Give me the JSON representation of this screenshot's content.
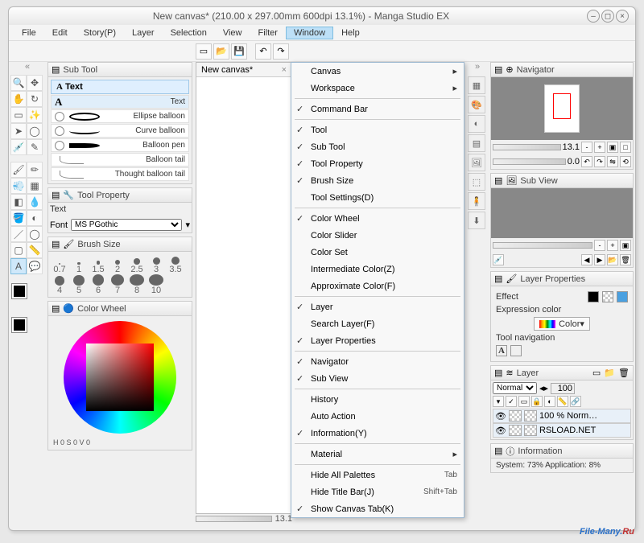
{
  "title": "New canvas* (210.00 x 297.00mm 600dpi 13.1%)  - Manga Studio EX",
  "menubar": [
    "File",
    "Edit",
    "Story(P)",
    "Layer",
    "Selection",
    "View",
    "Filter",
    "Window",
    "Help"
  ],
  "menubar_active": "Window",
  "canvas_tab": "New canvas*",
  "subtool": {
    "title": "Sub Tool",
    "tab": "Text",
    "items": [
      {
        "label": "Text",
        "icon": "A"
      },
      {
        "label": "Ellipse balloon",
        "icon": "ellipse"
      },
      {
        "label": "Curve balloon",
        "icon": "curve"
      },
      {
        "label": "Balloon pen",
        "icon": "swoosh"
      },
      {
        "label": "Balloon tail",
        "icon": "tail"
      },
      {
        "label": "Thought balloon tail",
        "icon": "tail"
      }
    ]
  },
  "toolprop": {
    "title": "Tool Property",
    "label": "Text",
    "font_label": "Font",
    "font_value": "MS PGothic"
  },
  "brush": {
    "title": "Brush Size",
    "sizes": [
      "0.7",
      "1",
      "1.5",
      "2",
      "2.5",
      "3",
      "3.5",
      "4",
      "5",
      "6",
      "7",
      "8",
      "10"
    ]
  },
  "colorwheel": {
    "title": "Color Wheel",
    "hsv": "H 0  S 0  V 0"
  },
  "dropdown": [
    {
      "type": "sub",
      "label": "Canvas"
    },
    {
      "type": "sub",
      "label": "Workspace"
    },
    {
      "type": "sep"
    },
    {
      "type": "chk",
      "label": "Command Bar",
      "checked": true
    },
    {
      "type": "sep"
    },
    {
      "type": "chk",
      "label": "Tool",
      "checked": true
    },
    {
      "type": "chk",
      "label": "Sub Tool",
      "checked": true
    },
    {
      "type": "chk",
      "label": "Tool Property",
      "checked": true
    },
    {
      "type": "chk",
      "label": "Brush Size",
      "checked": true
    },
    {
      "type": "item",
      "label": "Tool Settings(D)"
    },
    {
      "type": "sep"
    },
    {
      "type": "chk",
      "label": "Color Wheel",
      "checked": true
    },
    {
      "type": "item",
      "label": "Color Slider"
    },
    {
      "type": "item",
      "label": "Color Set"
    },
    {
      "type": "item",
      "label": "Intermediate Color(Z)"
    },
    {
      "type": "item",
      "label": "Approximate Color(F)"
    },
    {
      "type": "sep"
    },
    {
      "type": "chk",
      "label": "Layer",
      "checked": true
    },
    {
      "type": "item",
      "label": "Search Layer(F)"
    },
    {
      "type": "chk",
      "label": "Layer Properties",
      "checked": true
    },
    {
      "type": "sep"
    },
    {
      "type": "chk",
      "label": "Navigator",
      "checked": true
    },
    {
      "type": "chk",
      "label": "Sub View",
      "checked": true
    },
    {
      "type": "sep"
    },
    {
      "type": "item",
      "label": "History"
    },
    {
      "type": "item",
      "label": "Auto Action"
    },
    {
      "type": "chk",
      "label": "Information(Y)",
      "checked": true
    },
    {
      "type": "sep"
    },
    {
      "type": "sub",
      "label": "Material"
    },
    {
      "type": "sep"
    },
    {
      "type": "accel",
      "label": "Hide All Palettes",
      "accel": "Tab"
    },
    {
      "type": "accel",
      "label": "Hide Title Bar(J)",
      "accel": "Shift+Tab"
    },
    {
      "type": "chk",
      "label": "Show Canvas Tab(K)",
      "checked": true
    }
  ],
  "navigator": {
    "title": "Navigator",
    "zoom": "13.1",
    "angle": "0.0"
  },
  "subview": {
    "title": "Sub View"
  },
  "layerprop": {
    "title": "Layer Properties",
    "effect_label": "Effect",
    "expr_label": "Expression color",
    "expr_value": "Color",
    "toolnav_label": "Tool navigation"
  },
  "layer": {
    "title": "Layer",
    "blend": "Normal",
    "opacity": "100",
    "rows": [
      {
        "name": "100 %   Norm…"
      },
      {
        "name": "RSLOAD.NET"
      }
    ]
  },
  "info": {
    "title": "Information",
    "text": "System:  73%    Application:   8%"
  },
  "bottom_zoom": "13.1",
  "watermark": {
    "a": "File-Many.",
    "b": "Ru"
  }
}
